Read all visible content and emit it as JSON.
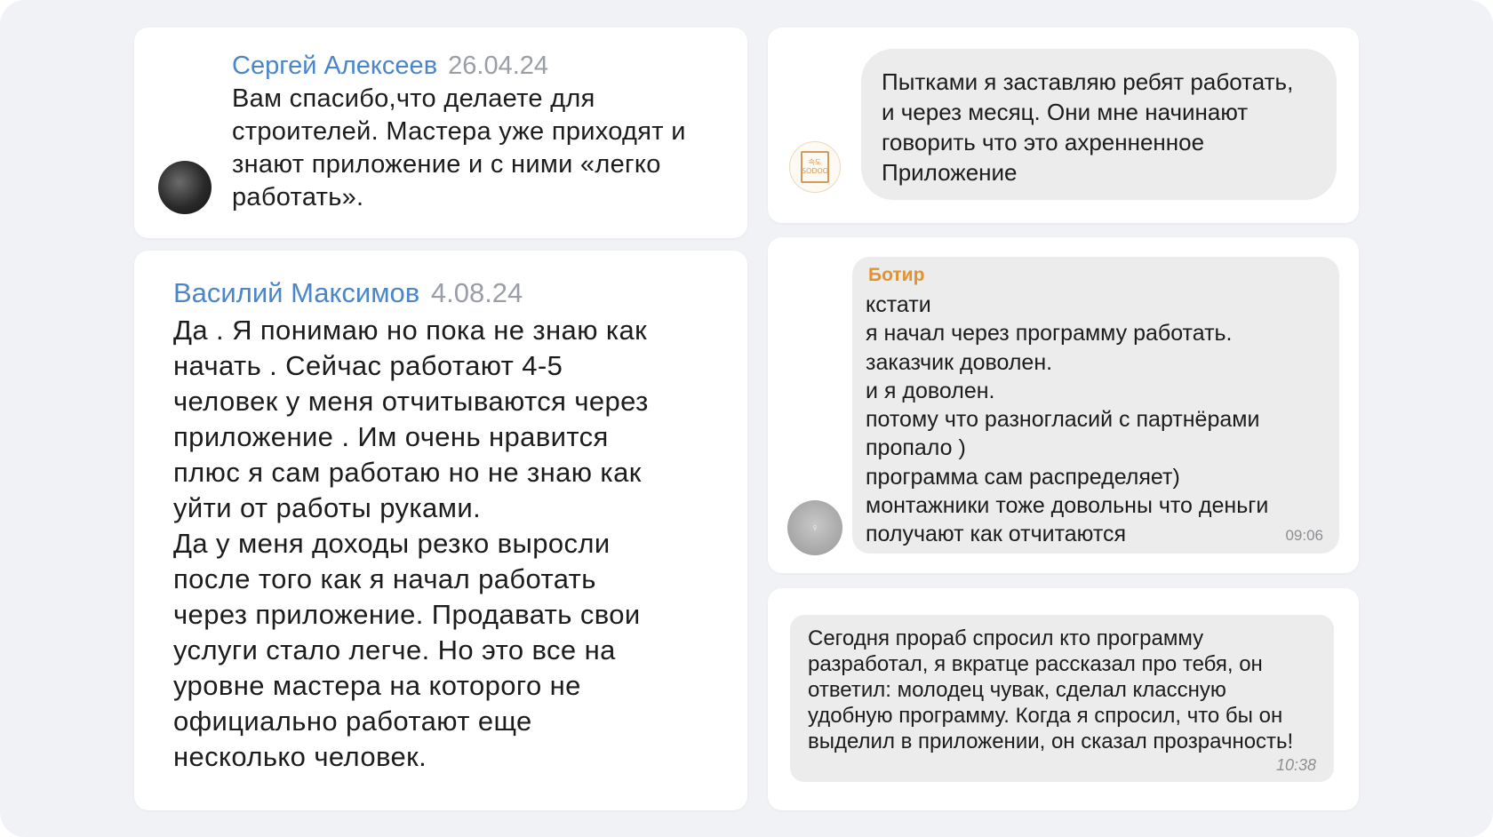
{
  "reviews": [
    {
      "author": "Сергей Алексеев",
      "date": "26.04.24",
      "text": "Вам спасибо,что делаете для\nстроителей. Мастера уже приходят и\nзнают приложение и с ними «легко\nработать»."
    },
    {
      "author": "Василий Максимов",
      "date": "4.08.24",
      "text": "Да . Я понимаю но пока не знаю как\nначать . Сейчас работают 4-5\nчеловек у меня отчитываются через\nприложение . Им очень нравится\nплюс я сам работаю но не знаю как\nуйти от работы руками.\nДа у меня доходы резко выросли\nпосле того как я начал работать\nчерез приложение. Продавать свои\nуслуги стало легче. Но это все на\nуровне мастера на которого не\nофициально работают еще\nнесколько человек."
    }
  ],
  "chats": [
    {
      "logo_text_top": "속도",
      "logo_text_bottom": "SODOO",
      "text": "Пытками я заставляю ребят работать,\nи через месяц. Они мне начинают\nговорить что это ахренненное\nПриложение"
    },
    {
      "sender": "Ботир",
      "text": "кстати\nя начал через программу работать.\nзаказчик доволен.\nи я доволен.\nпотому что разногласий с партнёрами\nпропало )\nпрограмма сам распределяет)\nмонтажники тоже довольны что деньги\nполучают как отчитаются",
      "time": "09:06"
    },
    {
      "text": "Сегодня прораб спросил кто программу\nразработал, я вкратце рассказал про тебя, он\nответил: молодец чувак, сделал классную\nудобную программу. Когда я спросил, что бы он\nвыделил в приложении, он сказал прозрачность!",
      "time": "10:38"
    }
  ]
}
